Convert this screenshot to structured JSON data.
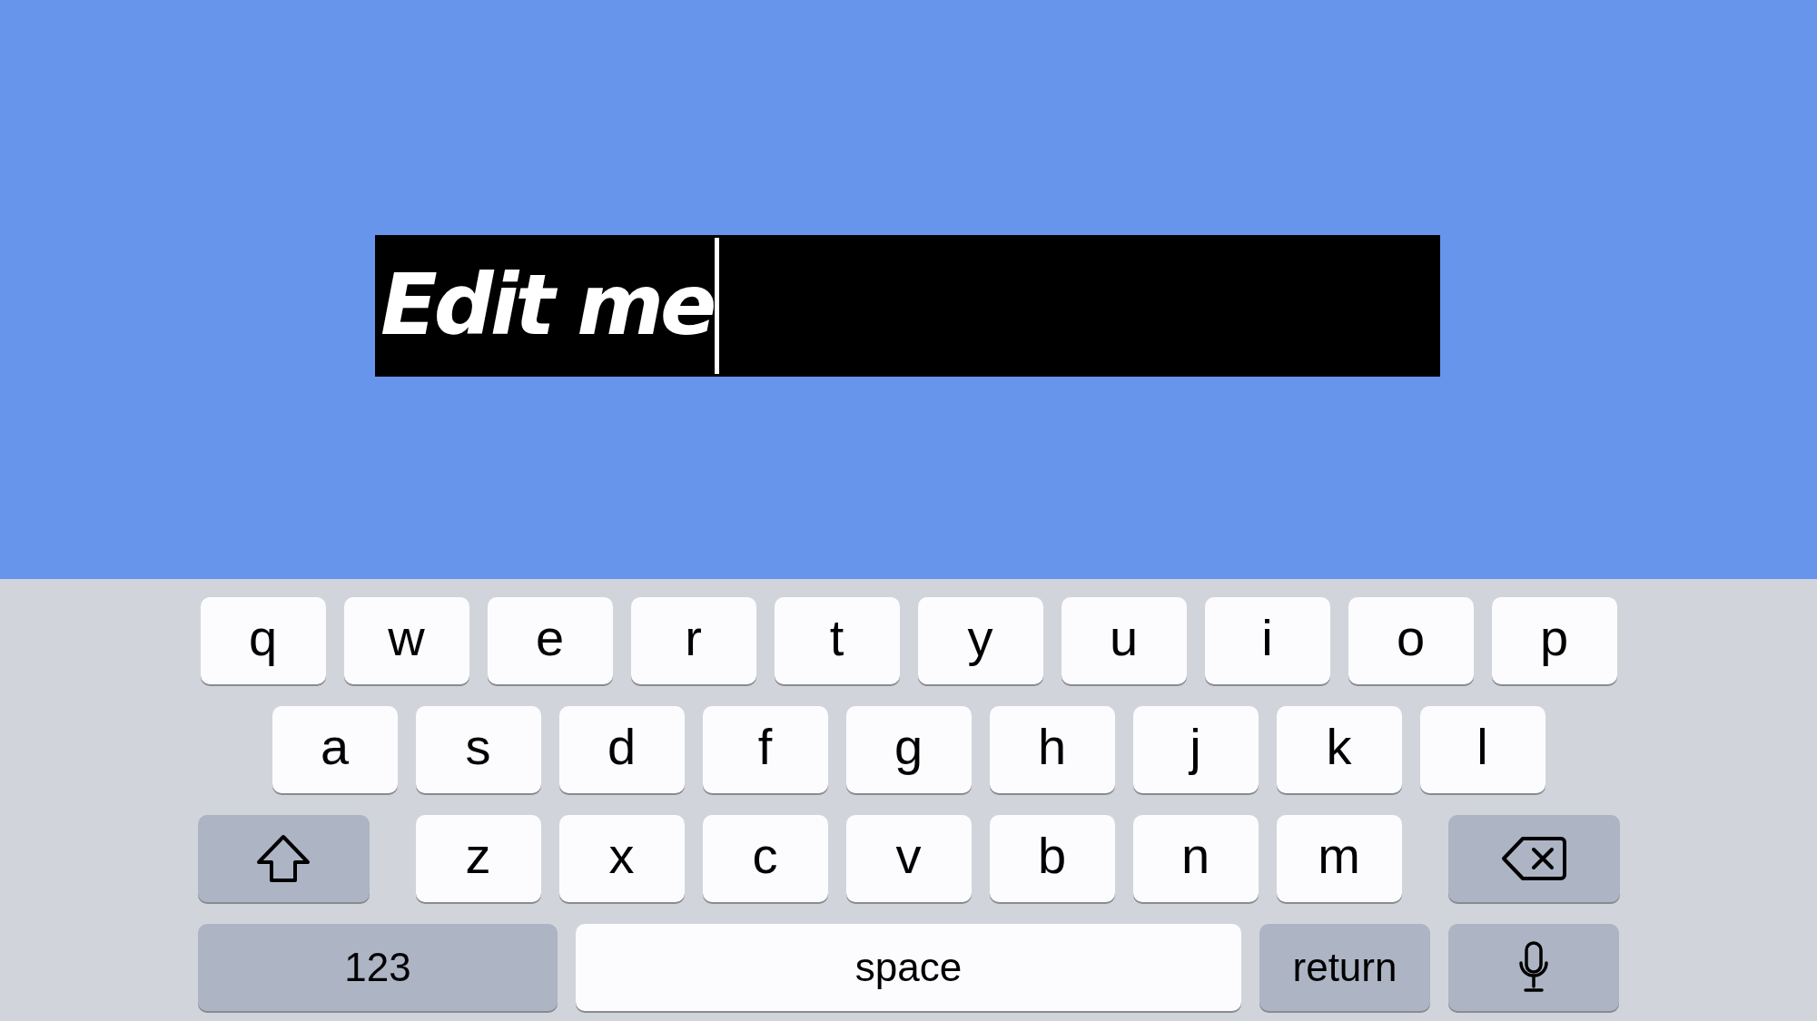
{
  "text_field": {
    "value": "Edit me",
    "focused": true
  },
  "keyboard": {
    "rows": [
      {
        "keys": [
          {
            "kind": "letter",
            "label": "q"
          },
          {
            "kind": "letter",
            "label": "w"
          },
          {
            "kind": "letter",
            "label": "e"
          },
          {
            "kind": "letter",
            "label": "r"
          },
          {
            "kind": "letter",
            "label": "t"
          },
          {
            "kind": "letter",
            "label": "y"
          },
          {
            "kind": "letter",
            "label": "u"
          },
          {
            "kind": "letter",
            "label": "i"
          },
          {
            "kind": "letter",
            "label": "o"
          },
          {
            "kind": "letter",
            "label": "p"
          }
        ]
      },
      {
        "keys": [
          {
            "kind": "letter",
            "label": "a"
          },
          {
            "kind": "letter",
            "label": "s"
          },
          {
            "kind": "letter",
            "label": "d"
          },
          {
            "kind": "letter",
            "label": "f"
          },
          {
            "kind": "letter",
            "label": "g"
          },
          {
            "kind": "letter",
            "label": "h"
          },
          {
            "kind": "letter",
            "label": "j"
          },
          {
            "kind": "letter",
            "label": "k"
          },
          {
            "kind": "letter",
            "label": "l"
          }
        ]
      },
      {
        "keys": [
          {
            "kind": "shift"
          },
          {
            "kind": "letter",
            "label": "z"
          },
          {
            "kind": "letter",
            "label": "x"
          },
          {
            "kind": "letter",
            "label": "c"
          },
          {
            "kind": "letter",
            "label": "v"
          },
          {
            "kind": "letter",
            "label": "b"
          },
          {
            "kind": "letter",
            "label": "n"
          },
          {
            "kind": "letter",
            "label": "m"
          },
          {
            "kind": "backspace"
          }
        ]
      },
      {
        "keys": [
          {
            "kind": "numbers",
            "label": "123"
          },
          {
            "kind": "space",
            "label": "space"
          },
          {
            "kind": "return",
            "label": "return"
          },
          {
            "kind": "mic"
          }
        ]
      }
    ]
  }
}
